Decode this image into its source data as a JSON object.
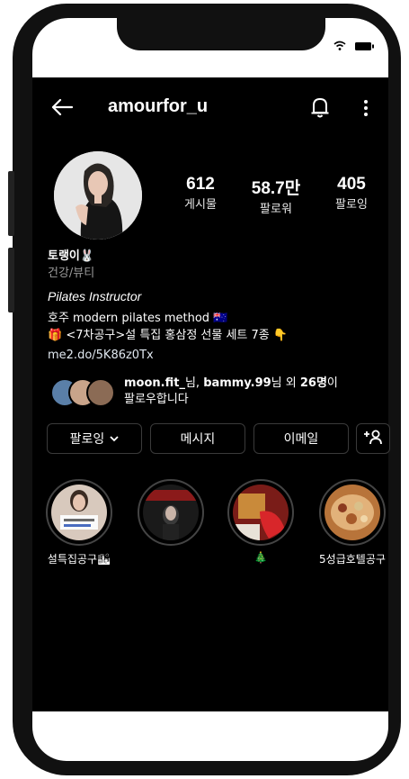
{
  "status_bar": {
    "wifi_icon": "wifi-icon",
    "battery_icon": "battery-icon"
  },
  "header": {
    "username": "amourfor_u",
    "back_icon": "arrow-left-icon",
    "bell_icon": "bell-icon",
    "menu_icon": "more-vertical-icon"
  },
  "stats": [
    {
      "value": "612",
      "label": "게시물"
    },
    {
      "value": "58.7만",
      "label": "팔로워"
    },
    {
      "value": "405",
      "label": "팔로잉"
    }
  ],
  "bio": {
    "name": "토랭이🐰",
    "category": "건강/뷰티",
    "title": "Pilates Instructor",
    "line1": "호주 modern pilates method 🇦🇺",
    "line2": "🎁 <7차공구>설 특집 홍삼정 선물 세트 7종 👇",
    "link": "me2.do/5K86z0Tx"
  },
  "followed_by": {
    "name1": "moon.fit_",
    "text1": "님, ",
    "name2": "bammy.99",
    "text2": "님 외 ",
    "count": "26명",
    "text3": "이",
    "line2": "팔로우합니다"
  },
  "buttons": {
    "following": "팔로잉",
    "message": "메시지",
    "email": "이메일",
    "add_person_icon": "add-person-icon"
  },
  "highlights": [
    {
      "label": "설특집공구🏙"
    },
    {
      "label": ""
    },
    {
      "label": "🎄"
    },
    {
      "label": "5성급호텔공구"
    }
  ]
}
